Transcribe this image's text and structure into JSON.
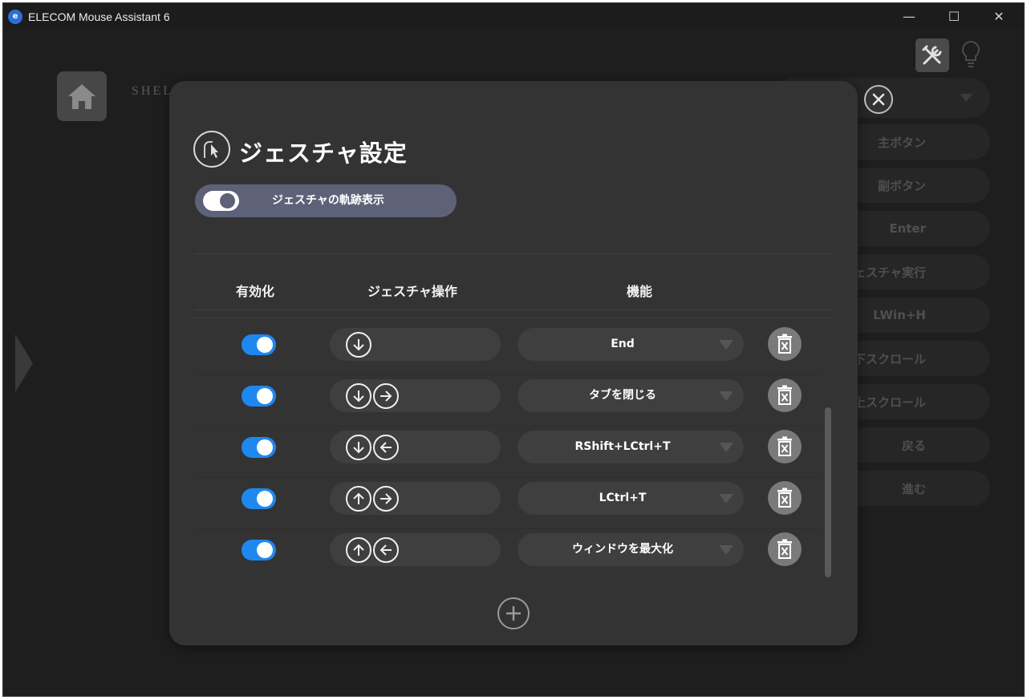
{
  "window": {
    "title": "ELECOM Mouse Assistant 6",
    "app_icon_glyph": "e",
    "controls": {
      "minimize": "—",
      "maximize": "☐",
      "close": "✕"
    }
  },
  "background": {
    "brand": "SHELL",
    "profile_selector": "",
    "buttons": [
      "主ボタン",
      "副ボタン",
      "Enter",
      "ジェスチャ実行",
      "LWin+H",
      "下スクロール",
      "上スクロール",
      "戻る",
      "進む"
    ]
  },
  "dialog": {
    "title": "ジェスチャ設定",
    "trail_toggle_label": "ジェスチャの軌跡表示",
    "trail_toggle_on": true,
    "columns": {
      "enable": "有効化",
      "gesture": "ジェスチャ操作",
      "function": "機能"
    },
    "rows": [
      {
        "enabled": true,
        "gesture": [
          "down-arrow-icon"
        ],
        "function": "End"
      },
      {
        "enabled": true,
        "gesture": [
          "down-arrow-icon",
          "right-arrow-icon"
        ],
        "function": "タブを閉じる"
      },
      {
        "enabled": true,
        "gesture": [
          "down-arrow-icon",
          "left-arrow-icon"
        ],
        "function": "RShift+LCtrl+T"
      },
      {
        "enabled": true,
        "gesture": [
          "up-arrow-icon",
          "right-arrow-icon"
        ],
        "function": "LCtrl+T"
      },
      {
        "enabled": true,
        "gesture": [
          "up-arrow-icon",
          "left-arrow-icon"
        ],
        "function": "ウィンドウを最大化"
      }
    ]
  },
  "colors": {
    "dialog_bg": "#333333",
    "toggle_on": "#1e88f0",
    "trail_toggle_bg": "#5d6278",
    "delete_bg": "#7a7a7a"
  }
}
